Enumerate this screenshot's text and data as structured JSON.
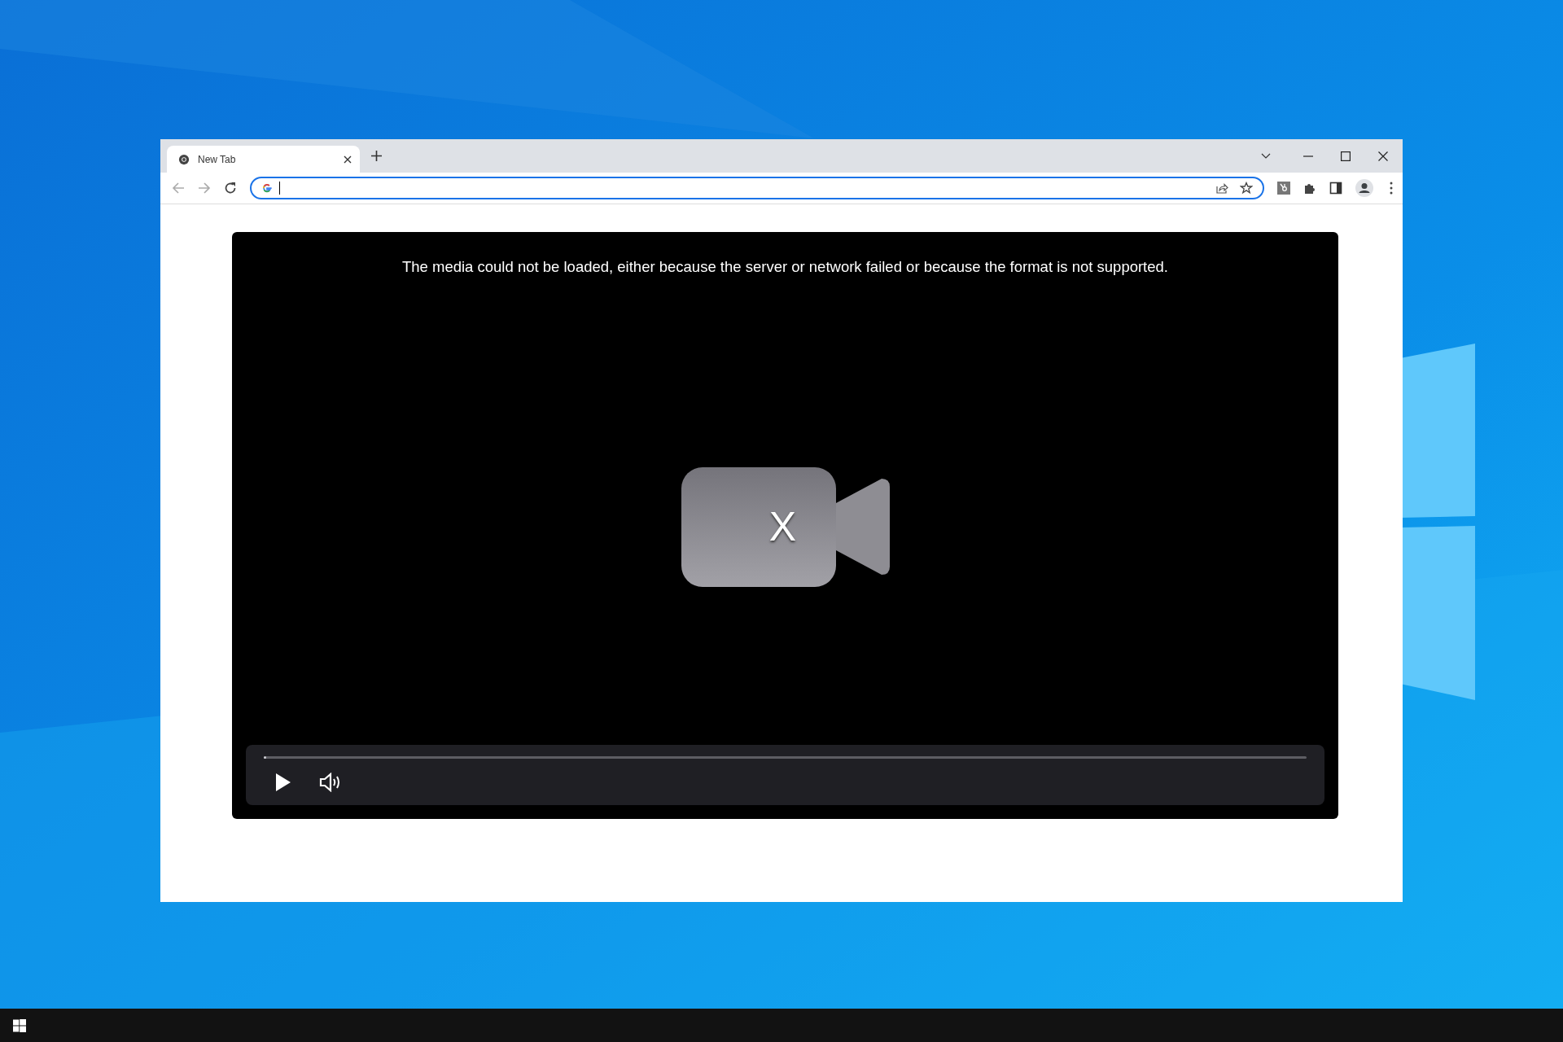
{
  "browser": {
    "tabs": [
      {
        "title": "New Tab",
        "selected": true
      }
    ]
  },
  "video": {
    "error_message": "The media could not be loaded, either because the server or network failed or because the format is not supported.",
    "error_mark": "X",
    "progress": {
      "level": 0
    }
  }
}
